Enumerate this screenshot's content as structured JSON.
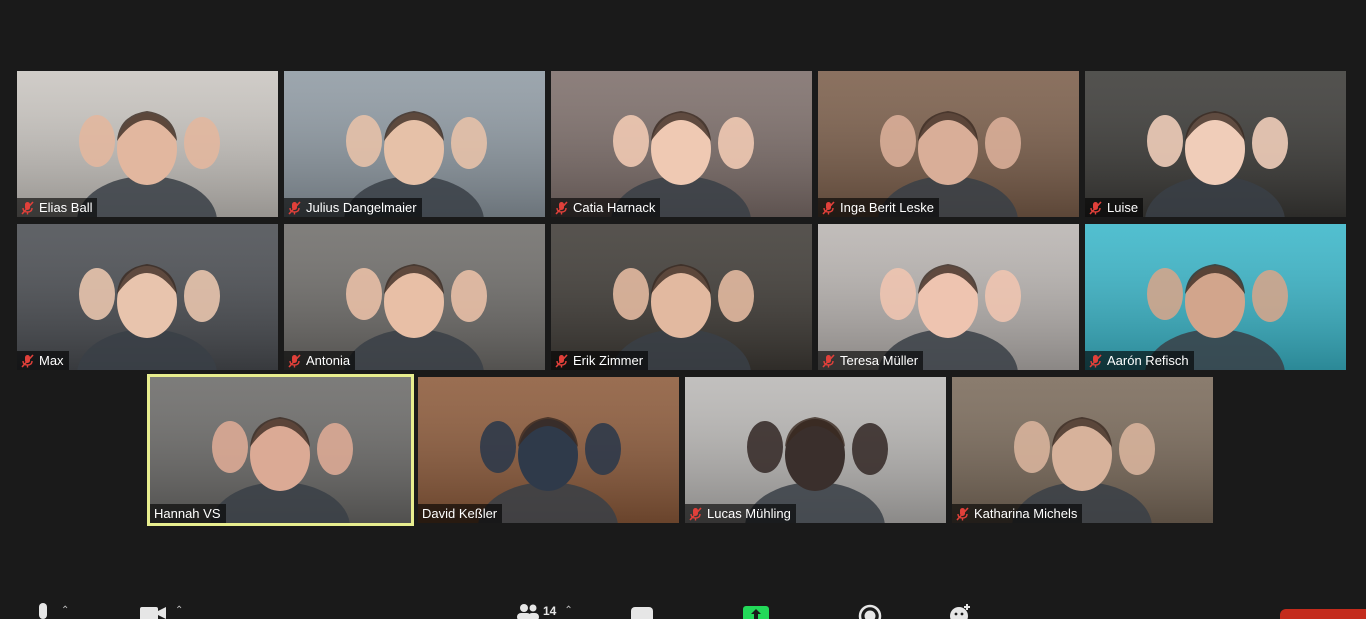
{
  "meeting": {
    "participants": [
      {
        "name": "Elias Ball",
        "muted": true,
        "bg": "#c9c5c0",
        "skin": "#e2b79f"
      },
      {
        "name": "Julius Dangelmaier",
        "muted": true,
        "bg": "#8f9aa3",
        "skin": "#e6c1a8"
      },
      {
        "name": "Catia Harnack",
        "muted": true,
        "bg": "#7d6e6a",
        "skin": "#efc9b3"
      },
      {
        "name": "Inga Berit Leske",
        "muted": true,
        "bg": "#7b5e4a",
        "skin": "#d9ae98"
      },
      {
        "name": "Luise",
        "muted": true,
        "bg": "#3b3a37",
        "skin": "#f0cdb9"
      },
      {
        "name": "Max",
        "muted": true,
        "bg": "#4a4d52",
        "skin": "#e8c4ad"
      },
      {
        "name": "Antonia",
        "muted": true,
        "bg": "#6f6d6a",
        "skin": "#e8bfa6"
      },
      {
        "name": "Erik Zimmer",
        "muted": true,
        "bg": "#3f3b36",
        "skin": "#e2b9a0"
      },
      {
        "name": "Teresa Müller",
        "muted": true,
        "bg": "#b9b4b1",
        "skin": "#eec4b0"
      },
      {
        "name": "Aarón Refisch",
        "muted": true,
        "bg": "#3ab6c9",
        "skin": "#d2a58c"
      },
      {
        "name": "Hannah VS",
        "muted": false,
        "bg": "#6b6a68",
        "skin": "#dbaa95",
        "active": true
      },
      {
        "name": "David Keßler",
        "muted": false,
        "bg": "#8c5a3a",
        "skin": "#2f3a4a"
      },
      {
        "name": "Lucas Mühling",
        "muted": true,
        "bg": "#b9b7b5",
        "skin": "#3a2f2c"
      },
      {
        "name": "Katharina Michels",
        "muted": true,
        "bg": "#7a6a5a",
        "skin": "#d7b29b"
      }
    ]
  },
  "toolbar": {
    "participants_count": "14",
    "icons": [
      "microphone-icon",
      "video-camera-icon",
      "participants-icon",
      "chat-icon",
      "share-screen-icon",
      "record-icon",
      "reactions-icon"
    ]
  },
  "colors": {
    "background": "#1a1a1a",
    "active_speaker": "#e8ee8f",
    "mute_red": "#e0403a",
    "share_green": "#23d959",
    "end_red": "#c42b1c"
  }
}
